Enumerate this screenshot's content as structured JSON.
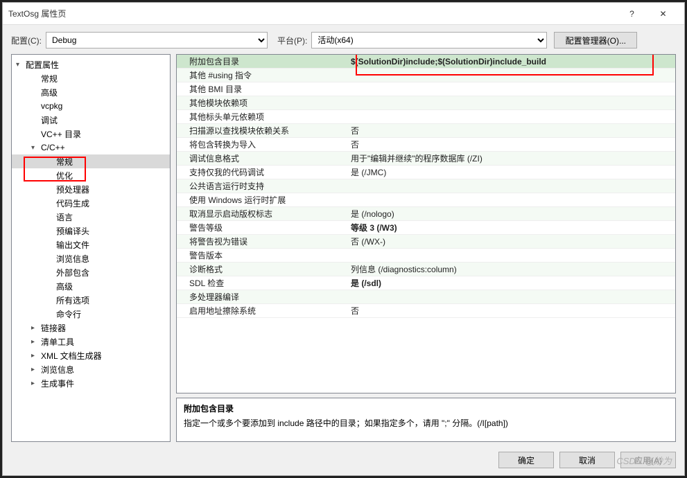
{
  "window_title": "TextOsg 属性页",
  "config_label": "配置(C):",
  "config_value": "Debug",
  "platform_label": "平台(P):",
  "platform_value": "活动(x64)",
  "config_mgr_btn": "配置管理器(O)...",
  "tree": [
    {
      "label": "配置属性",
      "indent": 0,
      "disclosure": "▾"
    },
    {
      "label": "常规",
      "indent": 1
    },
    {
      "label": "高级",
      "indent": 1
    },
    {
      "label": "vcpkg",
      "indent": 1
    },
    {
      "label": "调试",
      "indent": 1
    },
    {
      "label": "VC++ 目录",
      "indent": 1
    },
    {
      "label": "C/C++",
      "indent": 1,
      "disclosure": "▾",
      "redbox": true
    },
    {
      "label": "常规",
      "indent": 2,
      "sel": true
    },
    {
      "label": "优化",
      "indent": 2
    },
    {
      "label": "预处理器",
      "indent": 2
    },
    {
      "label": "代码生成",
      "indent": 2
    },
    {
      "label": "语言",
      "indent": 2
    },
    {
      "label": "预编译头",
      "indent": 2
    },
    {
      "label": "输出文件",
      "indent": 2
    },
    {
      "label": "浏览信息",
      "indent": 2
    },
    {
      "label": "外部包含",
      "indent": 2
    },
    {
      "label": "高级",
      "indent": 2
    },
    {
      "label": "所有选项",
      "indent": 2
    },
    {
      "label": "命令行",
      "indent": 2
    },
    {
      "label": "链接器",
      "indent": 1,
      "disclosure": "▸"
    },
    {
      "label": "清单工具",
      "indent": 1,
      "disclosure": "▸"
    },
    {
      "label": "XML 文档生成器",
      "indent": 1,
      "disclosure": "▸"
    },
    {
      "label": "浏览信息",
      "indent": 1,
      "disclosure": "▸"
    },
    {
      "label": "生成事件",
      "indent": 1,
      "disclosure": "▸"
    }
  ],
  "grid": [
    {
      "label": "附加包含目录",
      "value": "$(SolutionDir)include;$(SolutionDir)include_build",
      "sel": true,
      "bold": true
    },
    {
      "label": "其他 #using 指令",
      "value": ""
    },
    {
      "label": "其他 BMI 目录",
      "value": ""
    },
    {
      "label": "其他模块依赖项",
      "value": ""
    },
    {
      "label": "其他标头单元依赖项",
      "value": ""
    },
    {
      "label": "扫描源以查找模块依赖关系",
      "value": "否"
    },
    {
      "label": "将包含转换为导入",
      "value": "否"
    },
    {
      "label": "调试信息格式",
      "value": "用于\"编辑并继续\"的程序数据库 (/ZI)"
    },
    {
      "label": "支持仅我的代码调试",
      "value": "是 (/JMC)"
    },
    {
      "label": "公共语言运行时支持",
      "value": ""
    },
    {
      "label": "使用 Windows 运行时扩展",
      "value": ""
    },
    {
      "label": "取消显示启动版权标志",
      "value": "是 (/nologo)"
    },
    {
      "label": "警告等级",
      "value": "等级 3 (/W3)",
      "bold": true
    },
    {
      "label": "将警告视为错误",
      "value": "否 (/WX-)"
    },
    {
      "label": "警告版本",
      "value": ""
    },
    {
      "label": "诊断格式",
      "value": "列信息 (/diagnostics:column)"
    },
    {
      "label": "SDL 检查",
      "value": "是 (/sdl)",
      "bold": true
    },
    {
      "label": "多处理器编译",
      "value": ""
    },
    {
      "label": "启用地址擦除系统",
      "value": "否"
    }
  ],
  "desc_title": "附加包含目录",
  "desc_text": "指定一个或多个要添加到 include 路径中的目录；如果指定多个，请用 \";\" 分隔。(/I[path])",
  "btn_ok": "确定",
  "btn_cancel": "取消",
  "btn_apply": "应用(A)",
  "watermark": "CSDN @妙为"
}
